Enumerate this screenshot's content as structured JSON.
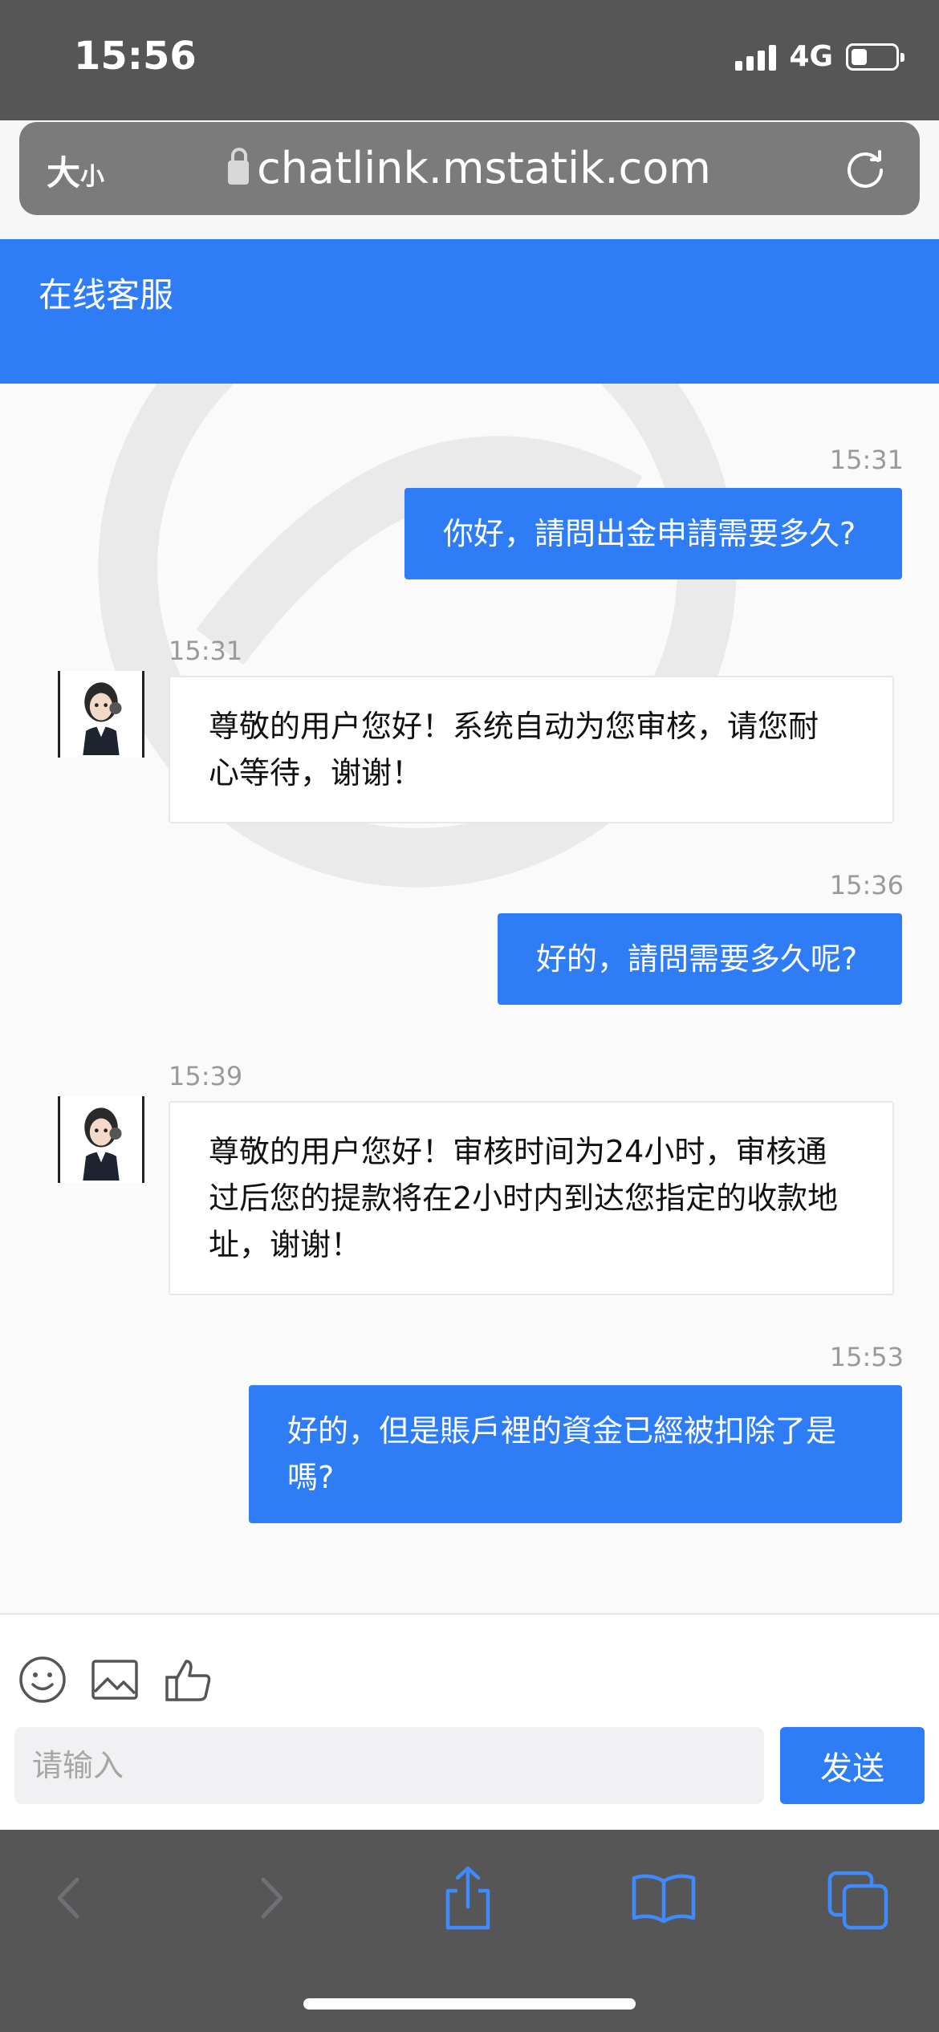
{
  "status_bar": {
    "time": "15:56",
    "network": "4G",
    "battery_level": 0.35
  },
  "browser": {
    "text_size_large": "大",
    "text_size_small": "小",
    "url": "chatlink.mstatik.com"
  },
  "app": {
    "title": "在线客服"
  },
  "messages": [
    {
      "sender": "user",
      "time": "15:31",
      "text": "你好，請問出金申請需要多久?"
    },
    {
      "sender": "agent",
      "time": "15:31",
      "lines": [
        "尊敬的用户您好！系统自动为您审核，请您耐",
        "心等待，谢谢！"
      ]
    },
    {
      "sender": "user",
      "time": "15:36",
      "text": "好的，請問需要多久呢?"
    },
    {
      "sender": "agent",
      "time": "15:39",
      "lines": [
        "尊敬的用户您好！审核时间为24小时，审核通",
        "过后您的提款将在2小时内到达您指定的收款地",
        "址，谢谢！"
      ]
    },
    {
      "sender": "user",
      "time": "15:53",
      "lines": [
        "好的，但是賬戶裡的資金已經被扣除了是",
        "嗎?"
      ]
    }
  ],
  "composer": {
    "placeholder": "请输入",
    "send_label": "发送"
  },
  "icons": {
    "toolbar": [
      "emoji-icon",
      "image-icon",
      "thumbs-up-icon"
    ],
    "browser": [
      "back-icon",
      "forward-icon",
      "share-icon",
      "bookmarks-icon",
      "tabs-icon"
    ]
  },
  "colors": {
    "accent": "#2f7df6",
    "system_bar": "#565657"
  }
}
